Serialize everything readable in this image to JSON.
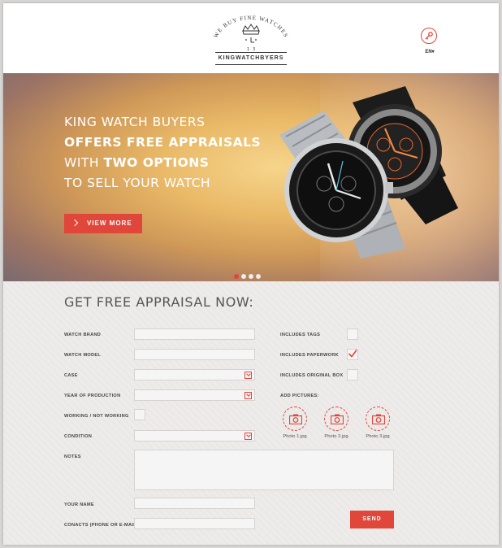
{
  "header": {
    "logo": {
      "top_arc_text": "WE BUY FINE WATCHES",
      "brand_name": "KINGWATCHBYERS",
      "digits": [
        "1",
        "3"
      ]
    },
    "language": "EN"
  },
  "hero": {
    "line1": "KING WATCH BUYERS",
    "line2": "OFFERS FREE APPRAISALS",
    "line3_prefix": "WITH",
    "line3_bold": "TWO OPTIONS",
    "line4": "TO SELL YOUR WATCH",
    "cta_label": "VIEW MORE",
    "carousel_active_index": 0,
    "carousel_count": 4
  },
  "form": {
    "title": "GET FREE APPRAISAL NOW:",
    "labels": {
      "watch_brand": "WATCH BRAND",
      "watch_model": "WATCH MODEL",
      "case": "CASE",
      "year": "YEAR OF PRODUCTION",
      "working": "WORKING / NOT WORKING",
      "condition": "CONDITION",
      "notes": "NOTES",
      "name": "YOUR NAME",
      "contacts": "CONACTS (PHONE OR E-MAIL)",
      "includes_tags": "INCLUDES TAGS",
      "includes_paperwork": "INCLUDES PAPERWORK",
      "includes_box": "INCLUDES ORIGINAL BOX",
      "add_pictures": "ADD PICTURES:"
    },
    "checkboxes": {
      "includes_tags": false,
      "includes_paperwork": true,
      "includes_box": false,
      "working": false
    },
    "photos": [
      "Photo 1.jpg",
      "Photo 2.jpg",
      "Photo 3.jpg"
    ],
    "send_label": "SEND"
  },
  "colors": {
    "accent": "#e0463a",
    "form_bg": "#ebe9e8",
    "field_bg": "#f6f5f5"
  }
}
